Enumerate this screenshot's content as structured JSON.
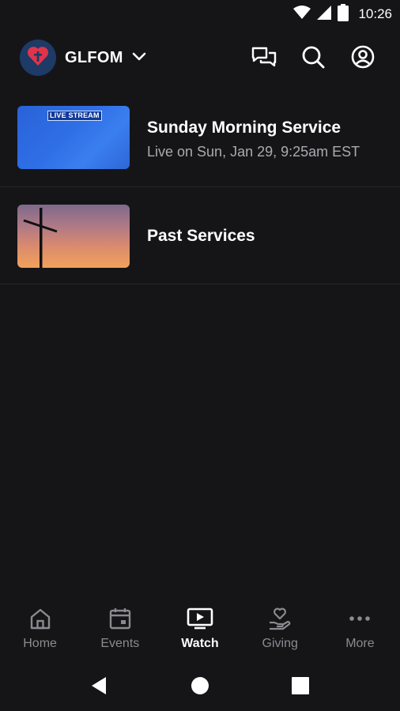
{
  "status_bar": {
    "time": "10:26"
  },
  "header": {
    "org_name": "GLFOM"
  },
  "items": [
    {
      "title": "Sunday Morning Service",
      "subtitle": "Live on Sun, Jan 29, 9:25am EST",
      "thumb_label": "LIVE STREAM"
    },
    {
      "title": "Past Services"
    }
  ],
  "tabs": [
    {
      "label": "Home",
      "icon": "home-icon",
      "active": false
    },
    {
      "label": "Events",
      "icon": "calendar-icon",
      "active": false
    },
    {
      "label": "Watch",
      "icon": "play-screen-icon",
      "active": true
    },
    {
      "label": "Giving",
      "icon": "giving-hand-icon",
      "active": false
    },
    {
      "label": "More",
      "icon": "more-dots-icon",
      "active": false
    }
  ],
  "colors": {
    "background": "#151518",
    "avatar_bg": "#1e3a66",
    "heart": "#e0344a",
    "inactive_tab": "#8a8b90",
    "active_tab": "#ffffff"
  }
}
